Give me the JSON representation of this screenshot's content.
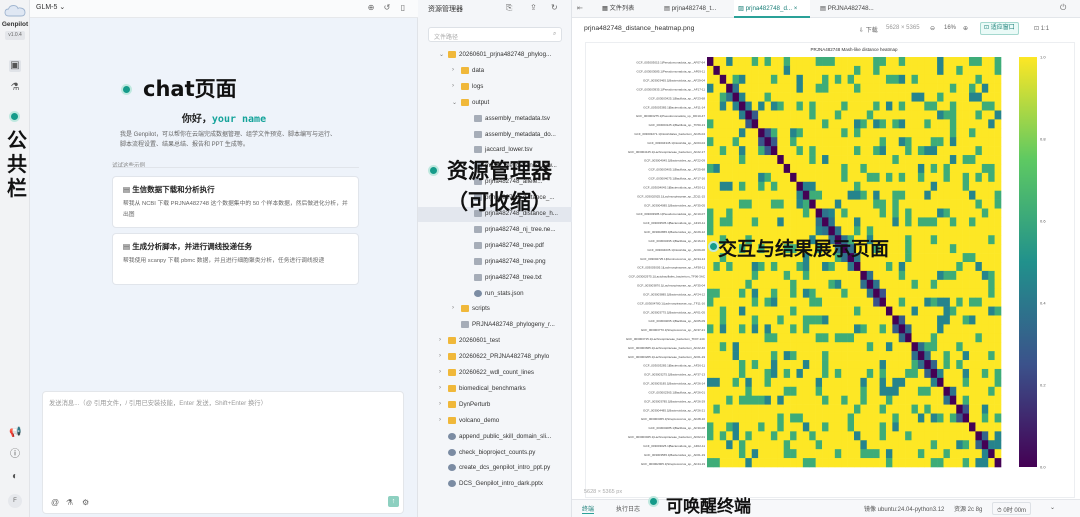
{
  "sidebar": {
    "brand": "Genpilot",
    "version": "v1.0.4"
  },
  "chat": {
    "model": "GLM-5",
    "greeting_prefix": "你好，",
    "greeting_name": "your name",
    "intro": "我是 Genpilot，可以帮你在云端完成数据管理、组学文件预览、脚本编写与运行、脚本流程设置、结果总结、报告和 PPT 生成等。",
    "examples_label": "试试这些示例",
    "examples": [
      {
        "title": "生信数据下载和分析执行",
        "desc": "帮我从 NCBI 下载 PRJNA482748 这个数据集中的 50 个样本数据，然后做进化分析，并出图"
      },
      {
        "title": "生成分析脚本，并进行调线投递任务",
        "desc": "帮我使用 scanpy 下载 pbmc 数据，并且进行细胞聚类分析，任务进行调线投递"
      }
    ],
    "input_placeholder": "发送消息...（@ 引用文件，/ 引用已安装技能，Enter 发送，Shift+Enter 换行）"
  },
  "explorer": {
    "title": "资源管理器",
    "search_placeholder": "文件路径",
    "rows": [
      {
        "label": "20260601_prjna482748_phylog...",
        "type": "folder",
        "open": true,
        "depth": 0
      },
      {
        "label": "data",
        "type": "folder",
        "open": false,
        "depth": 1
      },
      {
        "label": "logs",
        "type": "folder",
        "open": false,
        "depth": 1
      },
      {
        "label": "output",
        "type": "folder",
        "open": true,
        "depth": 1
      },
      {
        "label": "assembly_metadata.tsv",
        "type": "file",
        "depth": 2
      },
      {
        "label": "assembly_metadata_do...",
        "type": "file",
        "depth": 2
      },
      {
        "label": "jaccard_lower.tsv",
        "type": "file",
        "depth": 2
      },
      {
        "label": "mash_like_distance_low...",
        "type": "file",
        "depth": 2
      },
      {
        "label": "prjna482748_allele...",
        "type": "file",
        "depth": 2
      },
      {
        "label": "prjna482748_distance_...",
        "type": "file",
        "depth": 2
      },
      {
        "label": "prjna482748_distance_h...",
        "type": "file",
        "depth": 2,
        "selected": true
      },
      {
        "label": "prjna482748_nj_tree.ne...",
        "type": "file",
        "depth": 2
      },
      {
        "label": "prjna482748_tree.pdf",
        "type": "file",
        "depth": 2
      },
      {
        "label": "prjna482748_tree.png",
        "type": "file",
        "depth": 2
      },
      {
        "label": "prjna482748_tree.txt",
        "type": "file",
        "depth": 2
      },
      {
        "label": "run_stats.json",
        "type": "dot",
        "depth": 2
      },
      {
        "label": "scripts",
        "type": "folder",
        "open": false,
        "depth": 1
      },
      {
        "label": "PRJNA482748_phylogeny_r...",
        "type": "file",
        "depth": 1
      },
      {
        "label": "20260601_test",
        "type": "folder",
        "open": false,
        "depth": 0
      },
      {
        "label": "20260622_PRJNA482748_phylo",
        "type": "folder",
        "open": false,
        "depth": 0
      },
      {
        "label": "20260622_wdl_count_lines",
        "type": "folder",
        "open": false,
        "depth": 0
      },
      {
        "label": "biomedical_benchmarks",
        "type": "folder",
        "open": false,
        "depth": 0
      },
      {
        "label": "DynPerturb",
        "type": "folder",
        "open": false,
        "depth": 0
      },
      {
        "label": "volcano_demo",
        "type": "folder",
        "open": false,
        "depth": 0
      },
      {
        "label": "append_public_skill_domain_sli...",
        "type": "dot",
        "depth": 0
      },
      {
        "label": "check_bioproject_counts.py",
        "type": "dot",
        "depth": 0
      },
      {
        "label": "create_dcs_genpilot_intro_ppt.py",
        "type": "dot",
        "depth": 0
      },
      {
        "label": "DCS_Genpilot_intro_dark.pptx",
        "type": "dot",
        "depth": 0
      }
    ]
  },
  "viewer": {
    "tabs": [
      {
        "label": "文件列表",
        "active": false
      },
      {
        "label": "prjna482748_t...",
        "active": false
      },
      {
        "label": "prjna482748_d...",
        "active": true
      },
      {
        "label": "PRJNA482748...",
        "active": false
      }
    ],
    "filename": "prjna482748_distance_heatmap.png",
    "download": "下载",
    "dims": "5628 × 5365",
    "zoom": "16%",
    "fit": "适应窗口",
    "one_to_one": "1:1",
    "footer_dims": "5628 × 5365 px"
  },
  "terminal": {
    "tab1": "终端",
    "tab2": "执行日志",
    "env": "镜像 ubuntu:24.04-python3.12",
    "res": "资源 2c 8g",
    "time": "0时 00m"
  },
  "annotations": {
    "chat": "chat页面",
    "common": "公共栏",
    "explorer": "资源管理器\n（可收缩）",
    "interact": "交互与结果展示页面",
    "terminal": "可唤醒终端"
  },
  "chart_data": {
    "type": "heatmap",
    "title": "PRJNA482748 Mash-like distance heatmap",
    "colorbar_ticks": [
      "1.0",
      "0.8",
      "0.6",
      "0.4",
      "0.2",
      "0.0"
    ],
    "value_range": [
      0,
      1
    ],
    "n": 46,
    "row_labels": [
      "GCF_003003015.1|Pseudomonadota_sp._AF07-64",
      "GCF_003003085.1|Pseudomonadota_sp._AF09-11",
      "GCF_003003465.1|Bacteroidota_sp._AF29-04",
      "GCF_003003935.1|Pseudomonadota_sp._AF17-11",
      "GCF_003003425.1|Bacillota_sp._AF23-68",
      "GCF_003003385.1|Bacteroidota_sp._AF11-14",
      "GCF_003003275.1|Pseudomonadota_sp._DD10-47",
      "GCF_003003125.1|Bacillota_sp._TF50-13",
      "GCF_003003271.1|Clostridiales_bacterium_AF26-04",
      "GCF_003004345.1|Clostridia_sp._AF03-04",
      "GCF_003004125.1|Lachnospiraceae_bacterium_AF22-17",
      "GCF_003004045.1|Bacteroides_sp._AF22-09",
      "GCF_003003405.1|Bacillota_sp._AF25-68",
      "GCF_003004075.1|Bacillota_sp._AF17-16",
      "GCF_003004045.1|Bacteroidota_sp._AF20-11",
      "GCF_003002925.1|Lachnospiraceae_sp._ZD11-15",
      "GCF_003004085.1|Bacteroides_sp._AF35-05",
      "GCF_003003905.1|Pseudomonadota_sp._AF10-07",
      "GCF_003003535.1|Bacteroidota_sp._AF16-11",
      "GCF_003002865.1|Bacteroides_sp._AF29-12",
      "GCF_003003495.1|Bacillota_sp._AF16-01",
      "GCF_003004035.1|Clostridia_sp._AF09-00",
      "GCF_003002725.1|Ruminococcus_sp._AF34-14",
      "GCF_003003005.1|Lachnospiraceae_sp._AF38-11",
      "GCF_003002975.1|Lactobacillales_bacterium_TF06-3AC",
      "GCF_003003870.1|Lachnospiraceae_sp._AF35-04",
      "GCF_003003885.1|Bacteroidota_sp._AF24-12",
      "GCF_003004780.1|Lachnospiraceae_sp._TF11-16",
      "GCF_003003775.1|Bacteroidota_sp._AF01-05",
      "GCF_003004065.1|Bacillota_sp._AF05-09",
      "GCF_003003770.1|Streptococcus_sp._AF37-21",
      "GCF_003003715.1|Lachnospiraceae_bacterium_TF07-14C",
      "GCF_003003665.1|Lachnospiraceae_bacterium_AF22-40",
      "GCF_003003205.1|Lachnospiraceae_bacterium_AF01-19",
      "GCF_003003285.1|Bacteroidota_sp._AF26-11",
      "GCF_003003275.1|Bacteroides_sp._AF37-13",
      "GCF_003003185.1|Bacteroidota_sp._AF26-14",
      "GCF_003002365.1|Bacillota_sp._AF26-01",
      "GCF_003003785.1|Bacteroides_sp._AF26-29",
      "GCF_003004485.1|Bacteroidota_sp._AF26-21",
      "GCF_003003365.1|Streptococcus_sp._AF28-10",
      "GCF_003004085.1|Bacillota_sp._AF30-08",
      "GCF_003003025.1|Lachnospiraceae_bacterium_AF02-01",
      "GCF_003003025.1|Bacteroidota_sp._AF02-11",
      "GCF_003003565.1|Bacteroides_sp._AF01-19",
      "GCF_003002905.1|Streptococcus_sp._AF44-19"
    ]
  }
}
